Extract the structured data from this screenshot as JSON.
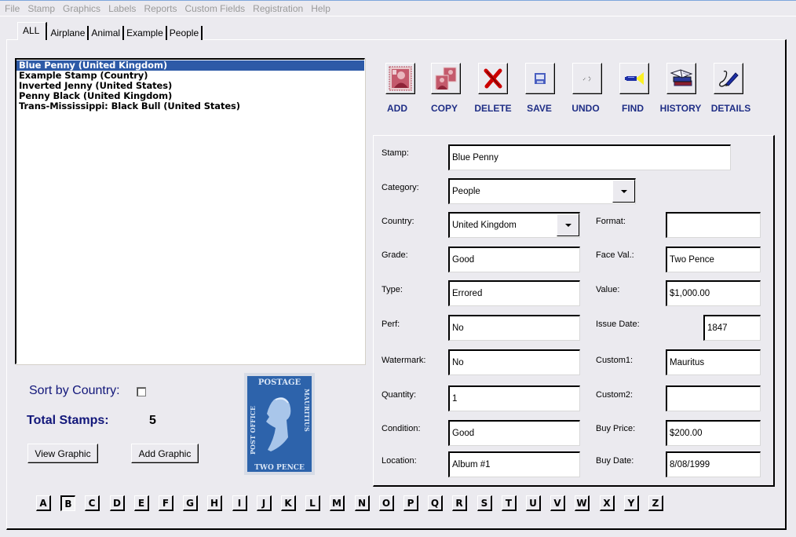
{
  "menu": [
    "File",
    "Stamp",
    "Graphics",
    "Labels",
    "Reports",
    "Custom Fields",
    "Registration",
    "Help"
  ],
  "tabs": [
    {
      "label": "ALL",
      "active": true
    },
    {
      "label": "Airplane",
      "active": false
    },
    {
      "label": "Animal",
      "active": false
    },
    {
      "label": "Example",
      "active": false
    },
    {
      "label": "People",
      "active": false
    }
  ],
  "stamp_list": [
    {
      "label": "Blue Penny (United Kingdom)",
      "selected": true
    },
    {
      "label": "Example Stamp (Country)",
      "selected": false
    },
    {
      "label": "Inverted Jenny (United States)",
      "selected": false
    },
    {
      "label": "Penny Black (United Kingdom)",
      "selected": false
    },
    {
      "label": "Trans-Mississippi: Black Bull (United States)",
      "selected": false
    }
  ],
  "toolbar": [
    {
      "label": "ADD",
      "icon": "add-stamp-icon"
    },
    {
      "label": "COPY",
      "icon": "copy-stamp-icon"
    },
    {
      "label": "DELETE",
      "icon": "delete-x-icon"
    },
    {
      "label": "SAVE",
      "icon": "save-icon"
    },
    {
      "label": "UNDO",
      "icon": "undo-icon"
    },
    {
      "label": "FIND",
      "icon": "flashlight-icon"
    },
    {
      "label": "HISTORY",
      "icon": "books-icon"
    },
    {
      "label": "DETAILS",
      "icon": "pencil-icon"
    }
  ],
  "form": {
    "stamp": {
      "label": "Stamp:",
      "value": "Blue Penny"
    },
    "category": {
      "label": "Category:",
      "value": "People"
    },
    "country": {
      "label": "Country:",
      "value": "United Kingdom"
    },
    "format": {
      "label": "Format:",
      "value": ""
    },
    "grade": {
      "label": "Grade:",
      "value": "Good"
    },
    "face_val": {
      "label": "Face Val.:",
      "value": "Two Pence"
    },
    "type": {
      "label": "Type:",
      "value": "Errored"
    },
    "value": {
      "label": "Value:",
      "value": "$1,000.00"
    },
    "perf": {
      "label": "Perf:",
      "value": "No"
    },
    "issue_date": {
      "label": "Issue Date:",
      "value": "1847"
    },
    "watermark": {
      "label": "Watermark:",
      "value": "No"
    },
    "custom1": {
      "label": "Custom1:",
      "value": "Mauritus"
    },
    "quantity": {
      "label": "Quantity:",
      "value": "1"
    },
    "custom2": {
      "label": "Custom2:",
      "value": ""
    },
    "condition": {
      "label": "Condition:",
      "value": "Good"
    },
    "buy_price": {
      "label": "Buy Price:",
      "value": "$200.00"
    },
    "location": {
      "label": "Location:",
      "value": "Album #1"
    },
    "buy_date": {
      "label": "Buy Date:",
      "value": "8/08/1999"
    }
  },
  "sort_by_country": {
    "label": "Sort by Country:",
    "checked": false
  },
  "total_stamps": {
    "label": "Total Stamps:",
    "value": "5"
  },
  "buttons": {
    "view_graphic": "View Graphic",
    "add_graphic": "Add Graphic"
  },
  "stamp_image": {
    "top_text": "POSTAGE",
    "bottom_text": "TWO PENCE",
    "left_text": "POST OFFICE",
    "right_text": "MAURITIUS"
  },
  "alphabet": [
    "A",
    "B",
    "C",
    "D",
    "E",
    "F",
    "G",
    "H",
    "I",
    "J",
    "K",
    "L",
    "M",
    "N",
    "O",
    "P",
    "Q",
    "R",
    "S",
    "T",
    "U",
    "V",
    "W",
    "X",
    "Y",
    "Z"
  ],
  "alphabet_pressed": "B",
  "colors": {
    "selection": "#2d5aa7",
    "label_blue": "#12177a",
    "toolbar_label": "#1f2e86"
  }
}
